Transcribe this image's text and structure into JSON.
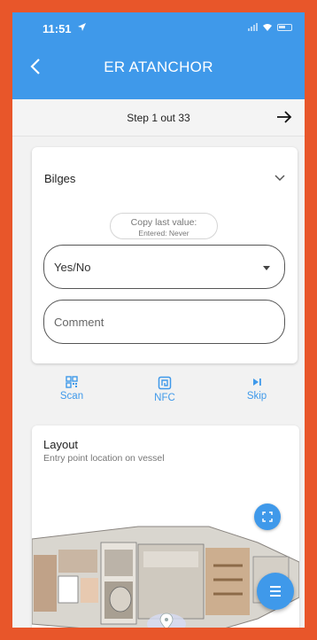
{
  "status_bar": {
    "time": "11:51"
  },
  "header": {
    "title": "ER ATANCHOR"
  },
  "step": {
    "text": "Step 1 out 33"
  },
  "checklist_item": {
    "title": "Bilges",
    "copy_last_value": {
      "label": "Copy last value:",
      "entered": "Entered: Never"
    },
    "answer_select": {
      "value": "Yes/No"
    },
    "comment_field": {
      "placeholder": "Comment"
    }
  },
  "actions": [
    {
      "label": "Scan",
      "icon": "qr-code-icon"
    },
    {
      "label": "NFC",
      "icon": "nfc-icon"
    },
    {
      "label": "Skip",
      "icon": "skip-icon"
    }
  ],
  "layout_card": {
    "title": "Layout",
    "subtitle": "Entry point location on vessel"
  },
  "colors": {
    "accent": "#3f99ea",
    "frame": "#e8562a",
    "background": "#f2f2f2"
  }
}
